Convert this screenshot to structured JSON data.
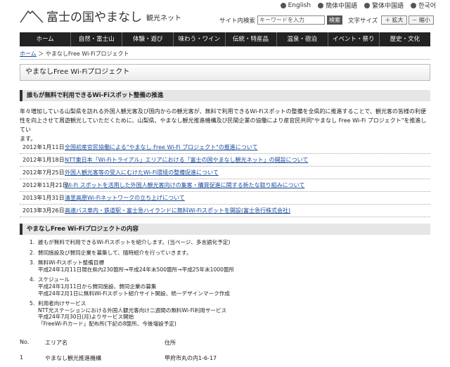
{
  "header": {
    "logo_main": "富士の国やまなし",
    "logo_sub": "観光ネット",
    "languages": [
      "English",
      "簡体中国語",
      "繁体中国語",
      "한국어"
    ],
    "search_label": "サイト内検索",
    "search_placeholder": "キーワードを入力",
    "search_button": "検索",
    "text_size_label": "文字サイズ",
    "enlarge_button": "＋ 拡大",
    "shrink_button": "－ 縮小"
  },
  "nav": [
    "ホーム",
    "自然・富士山",
    "体験・遊び",
    "味わう・ワイン",
    "伝統・特産品",
    "温泉・宿泊",
    "イベント・祭り",
    "歴史・文化"
  ],
  "breadcrumb": {
    "home": "ホーム",
    "separator": " ＞ ",
    "current": "やまなしFree Wi-Fiプロジェクト"
  },
  "page_title": "やまなしFree Wi-Fiプロジェクト",
  "section1": {
    "heading": "誰もが無料で利用できるWi-Fiスポット整備の推進",
    "intro_lines": [
      "年々増加している山梨県を訪れる外国人観光客及び国内からの観光客が、無料で利用できるWi-Fiスポットの整備を全県的に推進することで、観光客の皆様の利便",
      "性を向上させて周遊観光していただくために、山梨県、やまなし観光推進機構及び民間企業の協働により産官民共同\"やまなし Free Wi-Fi プロジェクト\"を推進してい",
      "ます。"
    ],
    "news": [
      {
        "date": "2012年1月11日",
        "text": "全国初産官民協働による\"やまなし Free Wi-Fi プロジェクト\"の推進について"
      },
      {
        "date": "2012年1月18日",
        "text": "NTT東日本「Wi-Fiトライアル」エリアにおける「富士の国やまなし観光ネット」の開設について"
      },
      {
        "date": "2012年7月25日",
        "text": "外国人観光客等の受入にむけたWi-Fi環境の整備促進について"
      },
      {
        "date": "2012年11月21日",
        "text": "Wi-Fi スポットを活用した外国人観光客向けの集客・購買促進に関する新たな取り組みについて"
      },
      {
        "date": "2013年1月31日",
        "text": "清里高原Wi-Fiネットワークの立ち上げについて"
      },
      {
        "date": "2013年3月26日",
        "text": "高速バス車内・鉄道駅・富士急ハイランドに無料Wi-Fiスポットを開設(富士急行株式会社)"
      }
    ]
  },
  "section2": {
    "heading": "やまなしFree Wi-Fiプロジェクトの内容",
    "items": [
      {
        "num": "1.",
        "lines": [
          "誰もが無料で利用できるWi-Fiスポットを紹介します。(当ページ、多言語化予定)"
        ]
      },
      {
        "num": "2.",
        "lines": [
          "賛同施設及び賛同企業を募集して、随時紹介を行っていきます。"
        ]
      },
      {
        "num": "3.",
        "lines": [
          "無料Wi-Fiスポット整備目標",
          "平成24年1月11日現在県内230箇所→平成24年末500箇所→平成25年末1000箇所"
        ]
      },
      {
        "num": "4.",
        "lines": [
          "スケジュール",
          "平成24年1月11日から賛同施設、賛同企業の募集",
          "平成24年2月1日に無料Wi-Fiスポット紹介サイト開設、統一デザインマーク作成"
        ]
      },
      {
        "num": "5.",
        "lines": [
          "利用者向けサービス",
          "NTT光ステーションにおける外国人観光客向け二週間の無料Wi-Fi利用サービス",
          "平成24年7月30日(月)よりサービス開始",
          "「FreeWi-Fiカード」配布所(下記の8箇所、今後増設予定)"
        ]
      }
    ]
  },
  "table": {
    "headers": [
      "No.",
      "エリア名",
      "住所"
    ],
    "rows": [
      {
        "no": "1",
        "area": "やまなし観光推進機構",
        "address": "甲府市丸の内1-6-17"
      }
    ]
  }
}
